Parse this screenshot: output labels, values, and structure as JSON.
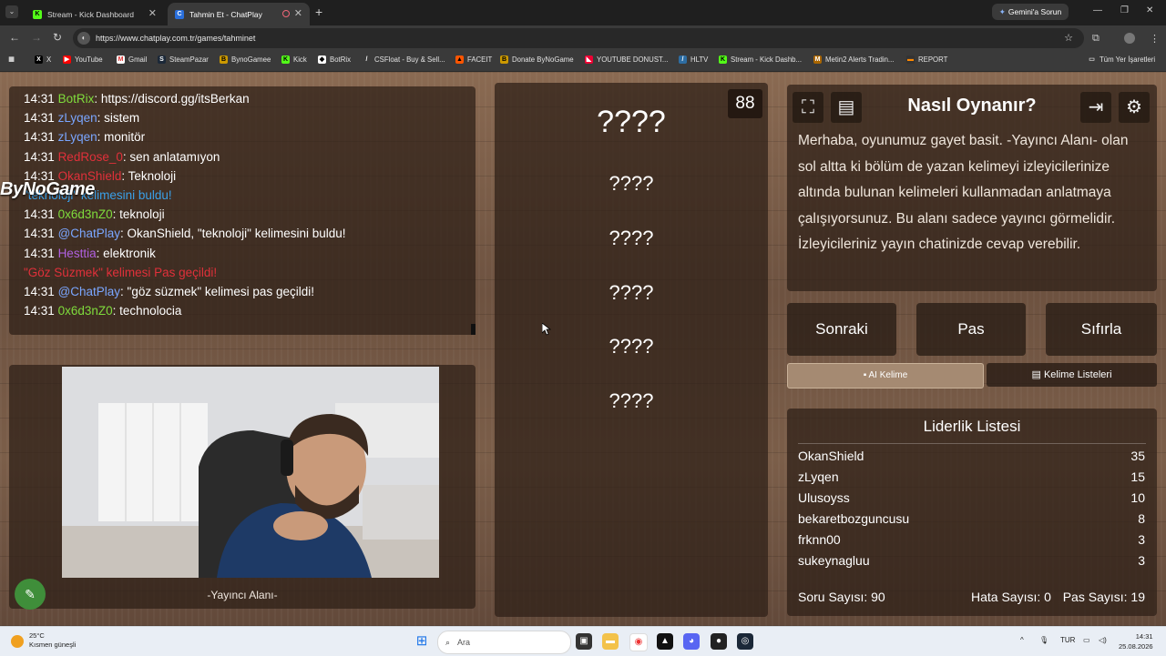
{
  "browser": {
    "tabs": [
      {
        "label": "Stream - Kick Dashboard",
        "active": false
      },
      {
        "label": "Tahmin Et - ChatPlay",
        "active": true
      }
    ],
    "gemini_label": "Gemini'a Sorun",
    "url": "https://www.chatplay.com.tr/games/tahminet",
    "bookmarks": [
      "X",
      "YouTube",
      "Gmail",
      "SteamPazar",
      "BynoGamee",
      "Kick",
      "BotRix",
      "CSFloat - Buy & Sell...",
      "FACEIT",
      "Donate ByNoGame",
      "YOUTUBE DONUST...",
      "HLTV",
      "Stream - Kick Dashb...",
      "Metin2 Alerts Tradin...",
      "REPORT"
    ],
    "all_bookmarks": "Tüm Yer İşaretleri"
  },
  "chat": {
    "messages": [
      {
        "time": "14:31",
        "user": "BotRix",
        "color": "#7fdc3c",
        "text": ": https://discord.gg/itsBerkan"
      },
      {
        "time": "14:31",
        "user": "zLyqen",
        "color": "#7aa6ff",
        "text": ": sistem"
      },
      {
        "time": "14:31",
        "user": "zLyqen",
        "color": "#7aa6ff",
        "text": ": monitör"
      },
      {
        "time": "14:31",
        "user": "RedRose_0",
        "color": "#e0303a",
        "text": ": sen anlatamıyon"
      },
      {
        "time": "14:31",
        "user": "OkanShield",
        "color": "#e0303a",
        "text": ": Teknoloji"
      },
      {
        "time": "",
        "user": "\"teknoloji\"",
        "color": "#3aa0e8",
        "text": " kelimesini buldu!"
      },
      {
        "time": "14:31",
        "user": "0x6d3nZ0",
        "color": "#7fdc3c",
        "text": ": teknoloji"
      },
      {
        "time": "14:31",
        "user": "@ChatPlay",
        "color": "#7aa6ff",
        "text": ": OkanShield, \"teknoloji\" kelimesini buldu!"
      },
      {
        "time": "14:31",
        "user": "Hesttia",
        "color": "#b060e0",
        "text": ": elektronik"
      },
      {
        "time": "",
        "user": "\"Göz Süzmek\"",
        "color": "#e0303a",
        "text": " kelimesi Pas geçildi!"
      },
      {
        "time": "14:31",
        "user": "@ChatPlay",
        "color": "#7aa6ff",
        "text": ": \"göz süzmek\" kelimesi pas geçildi!"
      },
      {
        "time": "14:31",
        "user": "0x6d3nZ0",
        "color": "#7fdc3c",
        "text": ": technolocia"
      }
    ],
    "overlay_logo": "ByNoGame"
  },
  "camera": {
    "caption": "-Yayıncı Alanı-"
  },
  "game": {
    "counter": "88",
    "hidden_words": [
      "????",
      "????",
      "????",
      "????",
      "????",
      "????"
    ]
  },
  "help": {
    "title": "Nasıl Oynanır?",
    "body": "Merhaba, oyunumuz gayet basit. -Yayıncı Alanı- olan sol altta ki bölüm de yazan kelimeyi izleyicilerinize altında bulunan kelimeleri kullanmadan anlatmaya çalışıyorsunuz. Bu alanı sadece yayıncı görmelidir. İzleyicileriniz yayın chatinizde cevap verebilir."
  },
  "controls": {
    "next": "Sonraki",
    "pass": "Pas",
    "reset": "Sıfırla",
    "ai_word": "AI Kelime",
    "word_lists": "Kelime Listeleri"
  },
  "leaderboard": {
    "title": "Liderlik Listesi",
    "rows": [
      {
        "name": "OkanShield",
        "score": "35"
      },
      {
        "name": "zLyqen",
        "score": "15"
      },
      {
        "name": "Ulusoyss",
        "score": "10"
      },
      {
        "name": "bekaretbozguncusu",
        "score": "8"
      },
      {
        "name": "frknn00",
        "score": "3"
      },
      {
        "name": "sukeynagluu",
        "score": "3"
      }
    ],
    "question_count": "Soru Sayısı: 90",
    "error_count": "Hata Sayısı: 0",
    "pass_count": "Pas Sayısı: 19"
  },
  "taskbar": {
    "temperature": "25°C",
    "weather": "Kısmen güneşli",
    "search_placeholder": "Ara",
    "lang": "TUR",
    "time": "14:31",
    "date": "25.08.2026"
  }
}
